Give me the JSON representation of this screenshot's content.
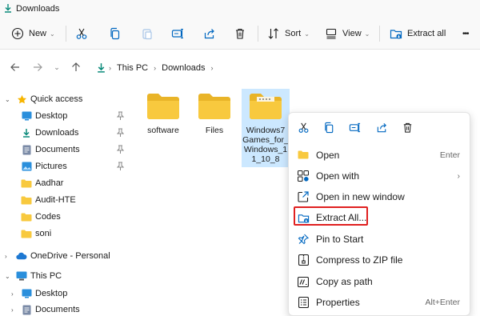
{
  "window": {
    "title": "Downloads",
    "title_icon": "download-arrow-icon"
  },
  "toolbar": {
    "new_label": "New",
    "sort_label": "Sort",
    "view_label": "View",
    "extract_label": "Extract all",
    "more_label": "•••"
  },
  "address": {
    "crumbs": [
      "This PC",
      "Downloads"
    ]
  },
  "sidebar": {
    "quick_access": "Quick access",
    "items": [
      {
        "label": "Desktop",
        "icon": "desktop-icon",
        "pinned": true
      },
      {
        "label": "Downloads",
        "icon": "download-icon",
        "pinned": true
      },
      {
        "label": "Documents",
        "icon": "documents-icon",
        "pinned": true
      },
      {
        "label": "Pictures",
        "icon": "pictures-icon",
        "pinned": true
      },
      {
        "label": "Aadhar",
        "icon": "folder-icon",
        "pinned": false
      },
      {
        "label": "Audit-HTE",
        "icon": "folder-icon",
        "pinned": false
      },
      {
        "label": "Codes",
        "icon": "folder-icon",
        "pinned": false
      },
      {
        "label": "soni",
        "icon": "folder-icon",
        "pinned": false
      }
    ],
    "onedrive": "OneDrive - Personal",
    "this_pc": "This PC",
    "pc_items": [
      {
        "label": "Desktop",
        "icon": "desktop-icon"
      },
      {
        "label": "Documents",
        "icon": "documents-icon"
      }
    ]
  },
  "files": [
    {
      "name": "software",
      "type": "folder"
    },
    {
      "name": "Files",
      "type": "folder"
    },
    {
      "name_lines": [
        "Windows7",
        "Games_for_",
        "Windows_1",
        "1_10_8"
      ],
      "type": "zip-folder",
      "selected": true
    }
  ],
  "context_menu": {
    "items": [
      {
        "label": "Open",
        "shortcut": "Enter",
        "icon": "open-icon"
      },
      {
        "label": "Open with",
        "submenu": "›",
        "icon": "open-with-icon"
      },
      {
        "label": "Open in new window",
        "icon": "new-window-icon"
      },
      {
        "label": "Extract All...",
        "icon": "extract-icon",
        "highlighted": true
      },
      {
        "label": "Pin to Start",
        "icon": "pin-icon"
      },
      {
        "label": "Compress to ZIP file",
        "icon": "zip-icon"
      },
      {
        "label": "Copy as path",
        "icon": "copy-path-icon"
      },
      {
        "label": "Properties",
        "shortcut": "Alt+Enter",
        "icon": "properties-icon"
      }
    ]
  },
  "colors": {
    "accent": "#0067c0",
    "folder": "#f8c93e",
    "selection": "#cce8ff",
    "highlight_border": "#e02020"
  }
}
